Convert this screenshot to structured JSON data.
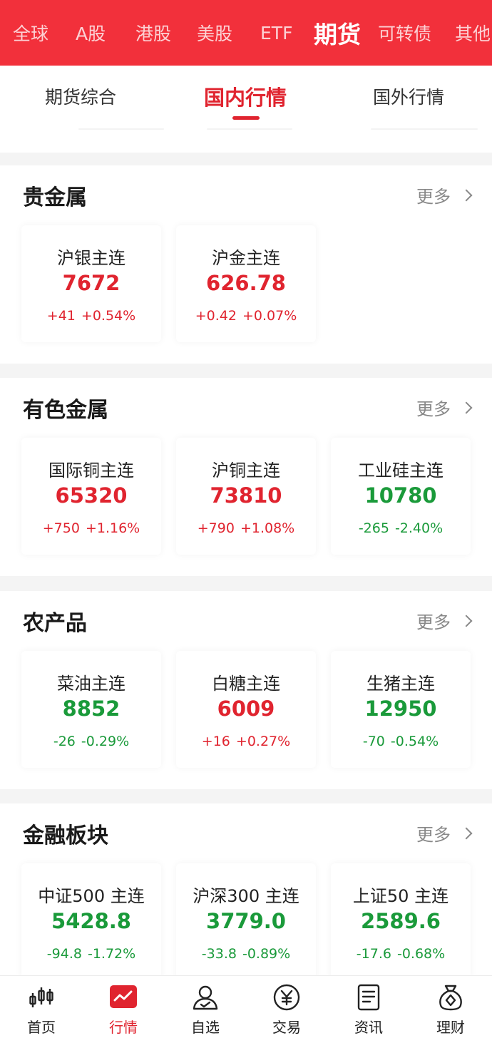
{
  "market_tabs": [
    {
      "label": "全球"
    },
    {
      "label": "A股"
    },
    {
      "label": "港股"
    },
    {
      "label": "美股"
    },
    {
      "label": "ETF"
    },
    {
      "label": "期货",
      "active": true
    },
    {
      "label": "可转债"
    },
    {
      "label": "其他"
    }
  ],
  "sub_tabs": [
    {
      "label": "期货综合"
    },
    {
      "label": "国内行情",
      "active": true
    },
    {
      "label": "国外行情"
    }
  ],
  "more_label": "更多",
  "sections": [
    {
      "title": "贵金属",
      "items": [
        {
          "name": "沪银主连",
          "price": "7672",
          "change": "+41",
          "pct": "+0.54%",
          "dir": "up"
        },
        {
          "name": "沪金主连",
          "price": "626.78",
          "change": "+0.42",
          "pct": "+0.07%",
          "dir": "up"
        }
      ]
    },
    {
      "title": "有色金属",
      "items": [
        {
          "name": "国际铜主连",
          "price": "65320",
          "change": "+750",
          "pct": "+1.16%",
          "dir": "up"
        },
        {
          "name": "沪铜主连",
          "price": "73810",
          "change": "+790",
          "pct": "+1.08%",
          "dir": "up"
        },
        {
          "name": "工业硅主连",
          "price": "10780",
          "change": "-265",
          "pct": "-2.40%",
          "dir": "down"
        }
      ]
    },
    {
      "title": "农产品",
      "items": [
        {
          "name": "菜油主连",
          "price": "8852",
          "change": "-26",
          "pct": "-0.29%",
          "dir": "down"
        },
        {
          "name": "白糖主连",
          "price": "6009",
          "change": "+16",
          "pct": "+0.27%",
          "dir": "up"
        },
        {
          "name": "生猪主连",
          "price": "12950",
          "change": "-70",
          "pct": "-0.54%",
          "dir": "down"
        }
      ]
    },
    {
      "title": "金融板块",
      "items": [
        {
          "name": "中证500 主连",
          "price": "5428.8",
          "change": "-94.8",
          "pct": "-1.72%",
          "dir": "down"
        },
        {
          "name": "沪深300 主连",
          "price": "3779.0",
          "change": "-33.8",
          "pct": "-0.89%",
          "dir": "down"
        },
        {
          "name": "上证50 主连",
          "price": "2589.6",
          "change": "-17.6",
          "pct": "-0.68%",
          "dir": "down"
        }
      ]
    }
  ],
  "bottom_nav": [
    {
      "label": "首页",
      "icon": "candlestick-icon"
    },
    {
      "label": "行情",
      "icon": "market-chart-icon",
      "active": true
    },
    {
      "label": "自选",
      "icon": "user-star-icon"
    },
    {
      "label": "交易",
      "icon": "yuan-coin-icon"
    },
    {
      "label": "资讯",
      "icon": "news-doc-icon"
    },
    {
      "label": "理财",
      "icon": "money-bag-icon"
    }
  ],
  "colors": {
    "brand_red": "#f2303b",
    "up": "#e0242f",
    "down": "#1a9a3a"
  }
}
